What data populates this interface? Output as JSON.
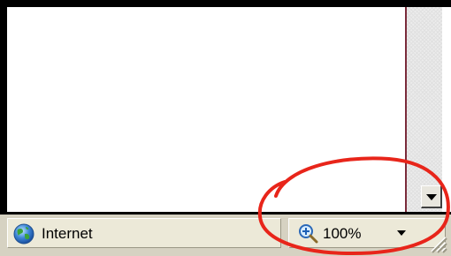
{
  "statusbar": {
    "zone_label": "Internet",
    "zoom_label": "100%"
  },
  "icons": {
    "zone": "globe-icon",
    "zoom": "magnifier-zoom-icon",
    "zoom_menu": "dropdown-arrow-icon",
    "scroll_down": "arrow-down-icon",
    "resize": "resize-grip-icon"
  },
  "colors": {
    "annotation_circle": "#e8251a",
    "statusbar_bg": "#ece9d8",
    "frame": "#000000",
    "content_edge": "#7a2b3a"
  }
}
